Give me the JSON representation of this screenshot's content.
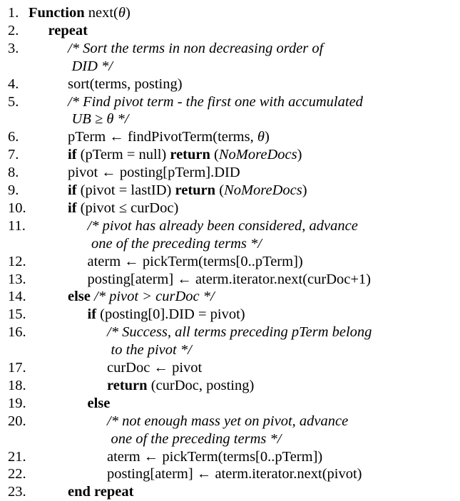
{
  "algorithm": {
    "lines": [
      {
        "num": "1.",
        "indent": 0,
        "parts": [
          {
            "t": "Function",
            "s": "b"
          },
          {
            "t": " next("
          },
          {
            "t": "θ",
            "s": "i"
          },
          {
            "t": ")"
          }
        ]
      },
      {
        "num": "2.",
        "indent": 1,
        "parts": [
          {
            "t": "repeat",
            "s": "b"
          }
        ]
      },
      {
        "num": "3.",
        "indent": 2,
        "parts": [
          {
            "t": "/* Sort the terms in non decreasing order of",
            "s": "i"
          }
        ]
      },
      {
        "num": "",
        "indent": 2.2,
        "parts": [
          {
            "t": "DID */",
            "s": "i"
          }
        ]
      },
      {
        "num": "4.",
        "indent": 2,
        "parts": [
          {
            "t": "sort(terms, posting)"
          }
        ]
      },
      {
        "num": "5.",
        "indent": 2,
        "parts": [
          {
            "t": "/* Find pivot term - the first one with accumulated",
            "s": "i"
          }
        ]
      },
      {
        "num": "",
        "indent": 2.2,
        "parts": [
          {
            "t": "UB ≥ θ */",
            "s": "i"
          }
        ]
      },
      {
        "num": "6.",
        "indent": 2,
        "parts": [
          {
            "t": "pTerm ← findPivotTerm(terms, "
          },
          {
            "t": "θ",
            "s": "i"
          },
          {
            "t": ")"
          }
        ]
      },
      {
        "num": "7.",
        "indent": 2,
        "parts": [
          {
            "t": "if",
            "s": "b"
          },
          {
            "t": " (pTerm = null) "
          },
          {
            "t": "return",
            "s": "b"
          },
          {
            "t": " ("
          },
          {
            "t": "NoMoreDocs",
            "s": "i"
          },
          {
            "t": ")"
          }
        ]
      },
      {
        "num": "8.",
        "indent": 2,
        "parts": [
          {
            "t": "pivot ← posting[pTerm].DID"
          }
        ]
      },
      {
        "num": "9.",
        "indent": 2,
        "parts": [
          {
            "t": "if",
            "s": "b"
          },
          {
            "t": " (pivot = lastID) "
          },
          {
            "t": "return",
            "s": "b"
          },
          {
            "t": " ("
          },
          {
            "t": "NoMoreDocs",
            "s": "i"
          },
          {
            "t": ")"
          }
        ]
      },
      {
        "num": "10.",
        "indent": 2,
        "parts": [
          {
            "t": "if",
            "s": "b"
          },
          {
            "t": " (pivot ≤ curDoc)"
          }
        ]
      },
      {
        "num": "11.",
        "indent": 3,
        "parts": [
          {
            "t": "/* pivot has already been considered, advance",
            "s": "i"
          }
        ]
      },
      {
        "num": "",
        "indent": 3.2,
        "parts": [
          {
            "t": "one of the preceding terms */",
            "s": "i"
          }
        ]
      },
      {
        "num": "12.",
        "indent": 3,
        "parts": [
          {
            "t": "aterm ← pickTerm(terms[0..pTerm])"
          }
        ]
      },
      {
        "num": "13.",
        "indent": 3,
        "parts": [
          {
            "t": "posting[aterm] ← aterm.iterator.next(curDoc+1)"
          }
        ]
      },
      {
        "num": "14.",
        "indent": 2,
        "parts": [
          {
            "t": "else",
            "s": "b"
          },
          {
            "t": " /* pivot > curDoc */",
            "s": "i"
          }
        ]
      },
      {
        "num": "15.",
        "indent": 3,
        "parts": [
          {
            "t": "if",
            "s": "b"
          },
          {
            "t": " (posting[0].DID = pivot)"
          }
        ]
      },
      {
        "num": "16.",
        "indent": 4,
        "parts": [
          {
            "t": "/* Success, all terms preceding pTerm belong",
            "s": "i"
          }
        ]
      },
      {
        "num": "",
        "indent": 4.2,
        "parts": [
          {
            "t": "to the pivot */",
            "s": "i"
          }
        ]
      },
      {
        "num": "17.",
        "indent": 4,
        "parts": [
          {
            "t": "curDoc ← pivot"
          }
        ]
      },
      {
        "num": "18.",
        "indent": 4,
        "parts": [
          {
            "t": "return",
            "s": "b"
          },
          {
            "t": " (curDoc, posting)"
          }
        ]
      },
      {
        "num": "19.",
        "indent": 3,
        "parts": [
          {
            "t": "else",
            "s": "b"
          }
        ]
      },
      {
        "num": "20.",
        "indent": 4,
        "parts": [
          {
            "t": "/* not enough mass yet on pivot, advance",
            "s": "i"
          }
        ]
      },
      {
        "num": "",
        "indent": 4.2,
        "parts": [
          {
            "t": "one of the preceding terms */",
            "s": "i"
          }
        ]
      },
      {
        "num": "21.",
        "indent": 4,
        "parts": [
          {
            "t": "aterm ← pickTerm(terms[0..pTerm])"
          }
        ]
      },
      {
        "num": "22.",
        "indent": 4,
        "parts": [
          {
            "t": "posting[aterm] ← aterm.iterator.next(pivot)"
          }
        ]
      },
      {
        "num": "23.",
        "indent": 2,
        "parts": [
          {
            "t": "end repeat",
            "s": "b"
          }
        ]
      }
    ]
  }
}
